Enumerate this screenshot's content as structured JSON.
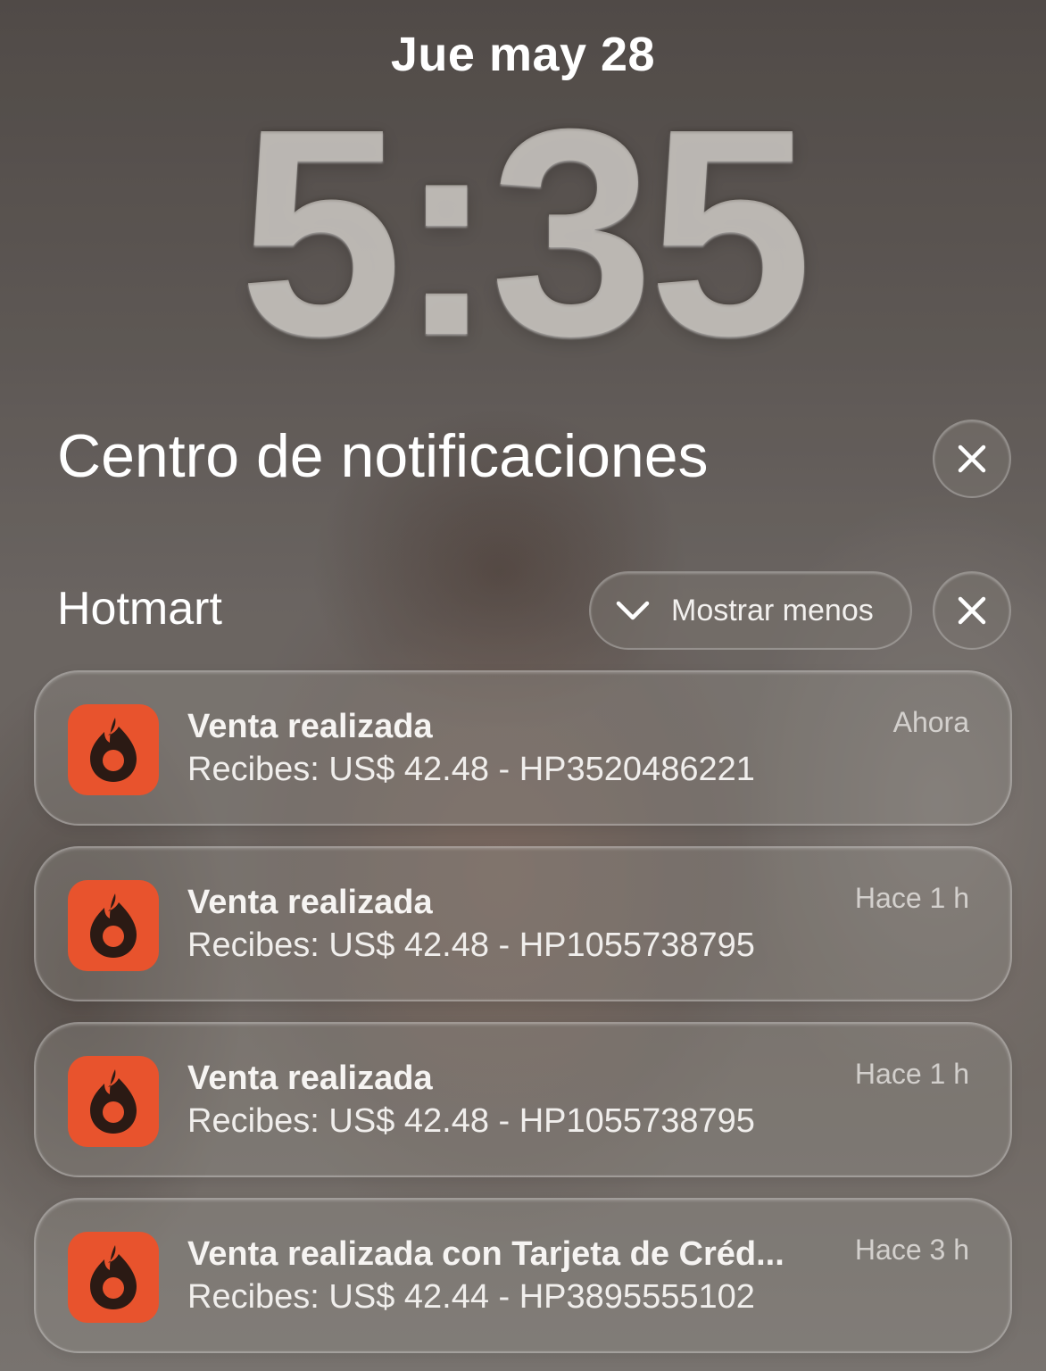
{
  "lockscreen": {
    "date": "Jue may 28",
    "time": "5:35"
  },
  "notification_center": {
    "title": "Centro de notificaciones",
    "close_icon": "close-icon"
  },
  "group": {
    "app_name": "Hotmart",
    "show_less_label": "Mostrar menos",
    "chevron_icon": "chevron-down-icon",
    "close_icon": "close-icon"
  },
  "notifications": [
    {
      "icon": "hotmart-app-icon",
      "title": "Venta realizada",
      "body": "Recibes: US$ 42.48 - HP3520486221",
      "time": "Ahora"
    },
    {
      "icon": "hotmart-app-icon",
      "title": "Venta realizada",
      "body": "Recibes: US$ 42.48 - HP1055738795",
      "time": "Hace 1 h"
    },
    {
      "icon": "hotmart-app-icon",
      "title": "Venta realizada",
      "body": "Recibes: US$ 42.48 - HP1055738795",
      "time": "Hace 1 h"
    },
    {
      "icon": "hotmart-app-icon",
      "title": "Venta realizada con Tarjeta de Créd...",
      "body": "Recibes: US$ 42.44 - HP3895555102",
      "time": "Hace 3 h"
    }
  ],
  "colors": {
    "app_icon_bg": "#e8532d",
    "app_icon_fg": "#2b1a14"
  }
}
